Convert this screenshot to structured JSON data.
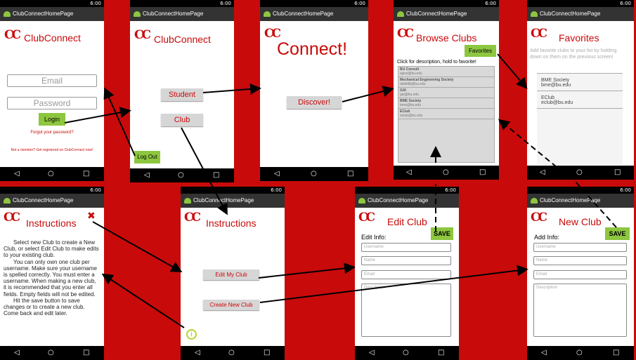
{
  "colors": {
    "background": "#c90a0a",
    "brand": "#c90a0a",
    "accent_green": "#8dc63f"
  },
  "common": {
    "status_time": "6:00",
    "logo": "CC",
    "nav_back": "◁",
    "nav_home": "○",
    "nav_recent": "□"
  },
  "login": {
    "title_bar": "ClubConnectHomePage",
    "app_title": "ClubConnect",
    "email_placeholder": "Email",
    "password_placeholder": "Password",
    "login_label": "Login",
    "forgot_link": "Forgot your password?",
    "register_link": "Not a member? Get registered on ClubConnect now!"
  },
  "home": {
    "title_bar": "ClubConnectHomePage",
    "app_title": "ClubConnect",
    "student_label": "Student",
    "club_label": "Club",
    "logout_label": "Log Out"
  },
  "connect": {
    "title_bar": "ClubConnectHomePage",
    "title": "Connect!",
    "discover_label": "Discover!"
  },
  "browse": {
    "title_bar": "ClubConnectHomePage",
    "title": "Browse Clubs",
    "favorites_label": "Favorites",
    "hint": "Click for description, hold to favorite!",
    "clubs": [
      {
        "name": "BU Consult",
        "email": "ajsss@bu.edu"
      },
      {
        "name": "Mechanical Engineering Society",
        "email": "deldidb@bu.edu"
      },
      {
        "name": "GAI",
        "email": "gai@bu.edu"
      },
      {
        "name": "BME Society",
        "email": "bme@bu.edu"
      },
      {
        "name": "EClub",
        "email": "eclub@bu.edu"
      }
    ]
  },
  "favorites": {
    "title_bar": "ClubConnectHomePage",
    "title": "Favorites",
    "hint": "Add favorite clubs to your list by holding down on them on the previous screen!",
    "items": [
      {
        "name": "BME Society",
        "email": "bme@bu.edu"
      },
      {
        "name": "EClub",
        "email": "eclub@bu.edu"
      }
    ]
  },
  "instructions_student": {
    "title_bar": "ClubConnectHomePage",
    "title": "Instructions",
    "close_glyph": "✖",
    "text_1": "Select new Club to create a New Club, or select Edit Club to make edits to your existing club.",
    "text_2": "You can only own one club per username. Make sure your username is spelled correctly. You must enter a username. When making a new club, it is recommended that you enter all fields. Empty fields will not be edited.",
    "text_3": "Hit the save button to save changes or to create a new club. Come back and edit later."
  },
  "instructions_club": {
    "title_bar": "ClubConnectHomePage",
    "title": "Instructions",
    "edit_label": "Edit My Club",
    "create_label": "Create New Club",
    "info_glyph": "i"
  },
  "edit_club": {
    "title_bar": "ClubConnectHomePage",
    "title": "Edit Club",
    "save_label": "SAVE",
    "section_label": "Edit Info:",
    "username_placeholder": "Username",
    "name_placeholder": "Name",
    "email_placeholder": "Email",
    "description_placeholder": "Description"
  },
  "new_club": {
    "title_bar": "ClubConnectHomePage",
    "title": "New Club",
    "save_label": "SAVE",
    "section_label": "Add Info:",
    "username_placeholder": "Username",
    "name_placeholder": "Name",
    "email_placeholder": "Email",
    "description_placeholder": "Description"
  }
}
